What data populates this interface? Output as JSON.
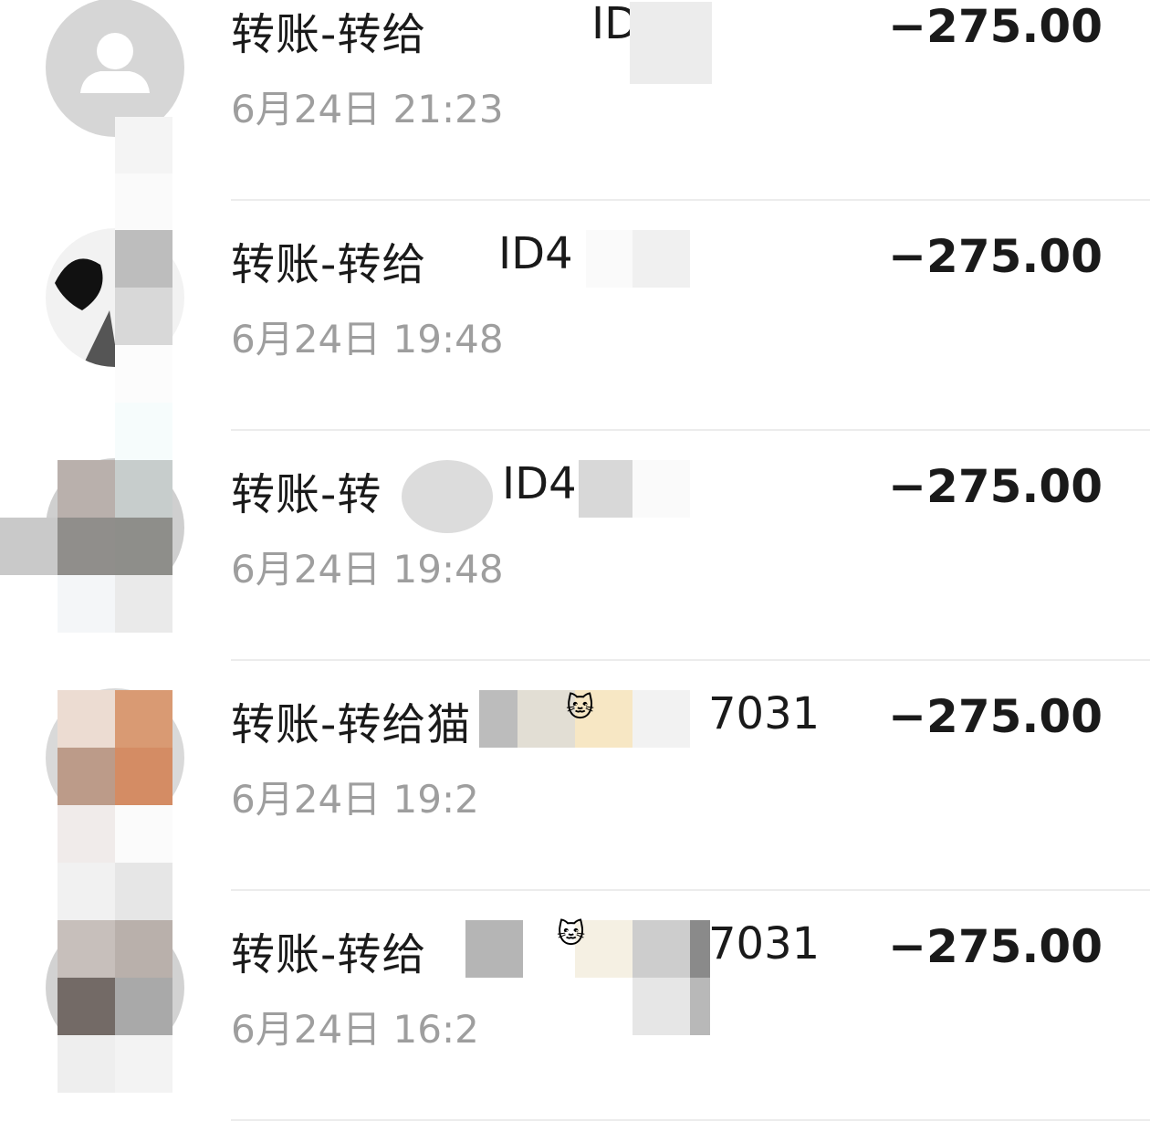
{
  "transactions": [
    {
      "title": "转账-转给",
      "account": "ID70",
      "time": "6月24日 21:23",
      "amount": "−275.00"
    },
    {
      "title": "转账-转给",
      "account": "ID4",
      "time": "6月24日 19:48",
      "amount": "−275.00"
    },
    {
      "title": "转账-转",
      "account": "ID4",
      "time": "6月24日 19:48",
      "amount": "−275.00"
    },
    {
      "title": "转账-转给猫",
      "account": "7031",
      "time": "6月24日 19:2",
      "amount": "−275.00"
    },
    {
      "title": "转账-转给",
      "account": "7031",
      "time": "6月24日 16:2",
      "amount": "−275.00"
    }
  ],
  "colors": {
    "text": "#1a1a1a",
    "subtext": "#9e9e9e",
    "divider": "#ececec"
  },
  "icons": [
    "default-user-avatar-icon",
    "user-avatar-icon",
    "cat-emoji-icon"
  ]
}
